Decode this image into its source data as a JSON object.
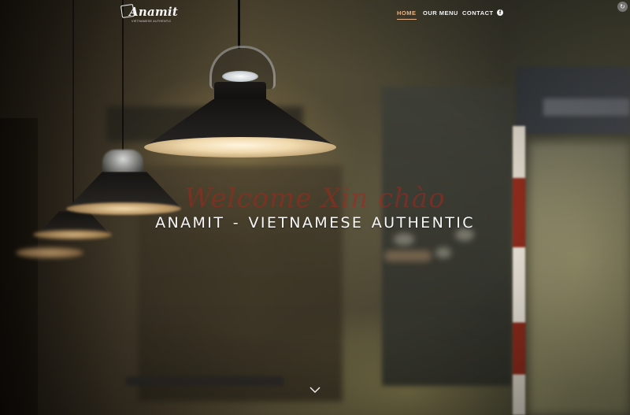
{
  "header": {
    "logo": {
      "wordmark": "Anamit",
      "tagline": "VIETNAMESE AUTHENTIC"
    },
    "nav": [
      {
        "label": "HOME",
        "active": true
      },
      {
        "label": "OUR MENU",
        "active": false
      },
      {
        "label": "CONTACT",
        "active": false
      }
    ],
    "social_icon": "facebook-icon",
    "accent_color": "#e7b489"
  },
  "hero": {
    "script_text": "Welcome  Xin chào",
    "title": "ANAMIT  -  VIETNAMESE  AUTHENTIC",
    "scroll_icon": "chevron-down-icon"
  },
  "corner_button_icon": "refresh-icon"
}
